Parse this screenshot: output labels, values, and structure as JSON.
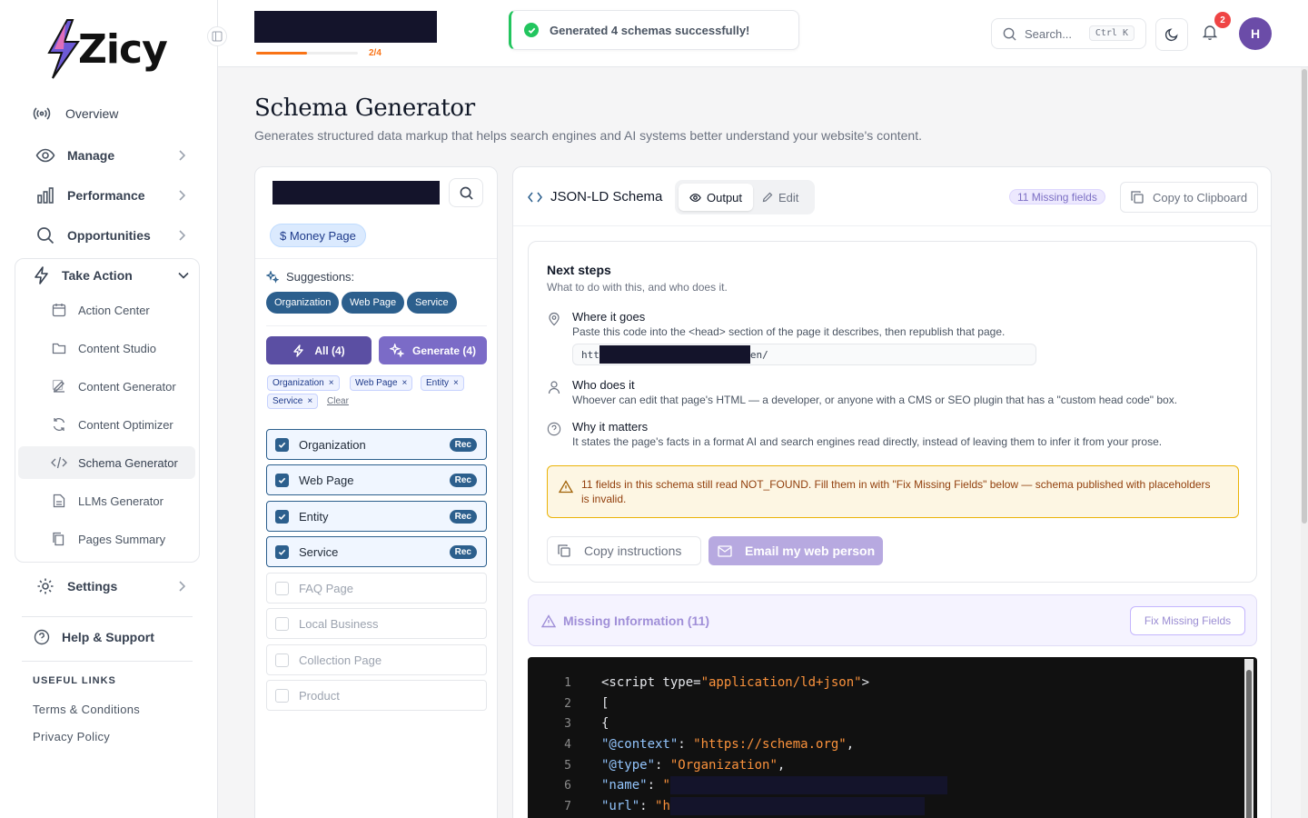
{
  "app": {
    "name": "Zicy"
  },
  "sidebar": {
    "nav": [
      {
        "label": "Overview",
        "icon": "broadcast-icon"
      },
      {
        "label": "Manage",
        "icon": "eye-icon"
      },
      {
        "label": "Performance",
        "icon": "bar-chart-icon"
      },
      {
        "label": "Opportunities",
        "icon": "search-icon"
      },
      {
        "label": "Take Action",
        "icon": "lightning-icon"
      },
      {
        "label": "Settings",
        "icon": "gear-icon"
      },
      {
        "label": "Help & Support",
        "icon": "help-circle-icon"
      }
    ],
    "sub": [
      {
        "label": "Action Center",
        "icon": "calendar-icon"
      },
      {
        "label": "Content Studio",
        "icon": "folder-icon"
      },
      {
        "label": "Content Generator",
        "icon": "edit-icon"
      },
      {
        "label": "Content Optimizer",
        "icon": "refresh-icon"
      },
      {
        "label": "Schema Generator",
        "icon": "code-icon"
      },
      {
        "label": "LLMs Generator",
        "icon": "file-icon"
      },
      {
        "label": "Pages Summary",
        "icon": "copy-icon"
      }
    ],
    "useful_title": "USEFUL LINKS",
    "links": [
      "Terms & Conditions",
      "Privacy Policy"
    ]
  },
  "topbar": {
    "progress_label": "2/4",
    "progress_fraction": 0.5,
    "toast": "Generated 4 schemas successfully!",
    "search_placeholder": "Search...",
    "shortcut": "Ctrl K",
    "notifications": "2",
    "avatar_initial": "H"
  },
  "page": {
    "title": "Schema Generator",
    "subtitle": "Generates structured data markup that helps search engines and AI systems better understand your website's content."
  },
  "left": {
    "page_chip": "$ Money Page",
    "suggestions_label": "Suggestions:",
    "suggestions": [
      "Organization",
      "Web Page",
      "Service"
    ],
    "all_button": "All (4)",
    "generate_button": "Generate (4)",
    "selected_tags": [
      "Organization",
      "Web Page",
      "Entity",
      "Service"
    ],
    "clear": "Clear",
    "rec_label": "Rec",
    "types": [
      {
        "label": "Organization",
        "checked": true
      },
      {
        "label": "Web Page",
        "checked": true
      },
      {
        "label": "Entity",
        "checked": true
      },
      {
        "label": "Service",
        "checked": true
      },
      {
        "label": "FAQ Page",
        "checked": false
      },
      {
        "label": "Local Business",
        "checked": false
      },
      {
        "label": "Collection Page",
        "checked": false
      },
      {
        "label": "Product",
        "checked": false
      }
    ]
  },
  "right": {
    "title": "JSON-LD Schema",
    "tab_output": "Output",
    "tab_edit": "Edit",
    "missing_pill": "11 Missing fields",
    "copy_clipboard": "Copy to Clipboard",
    "next_steps": {
      "heading": "Next steps",
      "sub": "What to do with this, and who does it.",
      "where_title": "Where it goes",
      "where_desc": "Paste this code into the <head> section of the page it describes, then republish that page.",
      "url_start": "htt",
      "url_end": "en/",
      "who_title": "Who does it",
      "who_desc": "Whoever can edit that page's HTML — a developer, or anyone with a CMS or SEO plugin that has a \"custom head code\" box.",
      "why_title": "Why it matters",
      "why_desc": "It states the page's facts in a format AI and search engines read directly, instead of leaving them to infer it from your prose.",
      "warning": "11 fields in this schema still read NOT_FOUND. Fill them in with \"Fix Missing Fields\" below — schema published with placeholders is invalid.",
      "copy_instructions": "Copy instructions",
      "email_button": "Email my web person"
    },
    "missing_info": "Missing Information (11)",
    "fix_button": "Fix Missing Fields",
    "code": {
      "line_numbers": [
        "1",
        "2",
        "3",
        "4",
        "5",
        "6",
        "7"
      ],
      "l1_tag": "<script type=",
      "l1_val": "\"application/ld+json\"",
      "l1_end": ">",
      "l2": "[",
      "l3": "{",
      "l4_key": "\"@context\"",
      "l4_val": "\"https://schema.org\"",
      "l5_key": "\"@type\"",
      "l5_val": "\"Organization\"",
      "l6_key": "\"name\"",
      "l6_val": "\"",
      "l7_key": "\"url\"",
      "l7_val": "\"h"
    }
  },
  "colors": {
    "primary": "#2c5f8d",
    "accent": "#5b4fa3",
    "success": "#22c55e",
    "warning": "#eab308",
    "progress": "#f97316"
  }
}
